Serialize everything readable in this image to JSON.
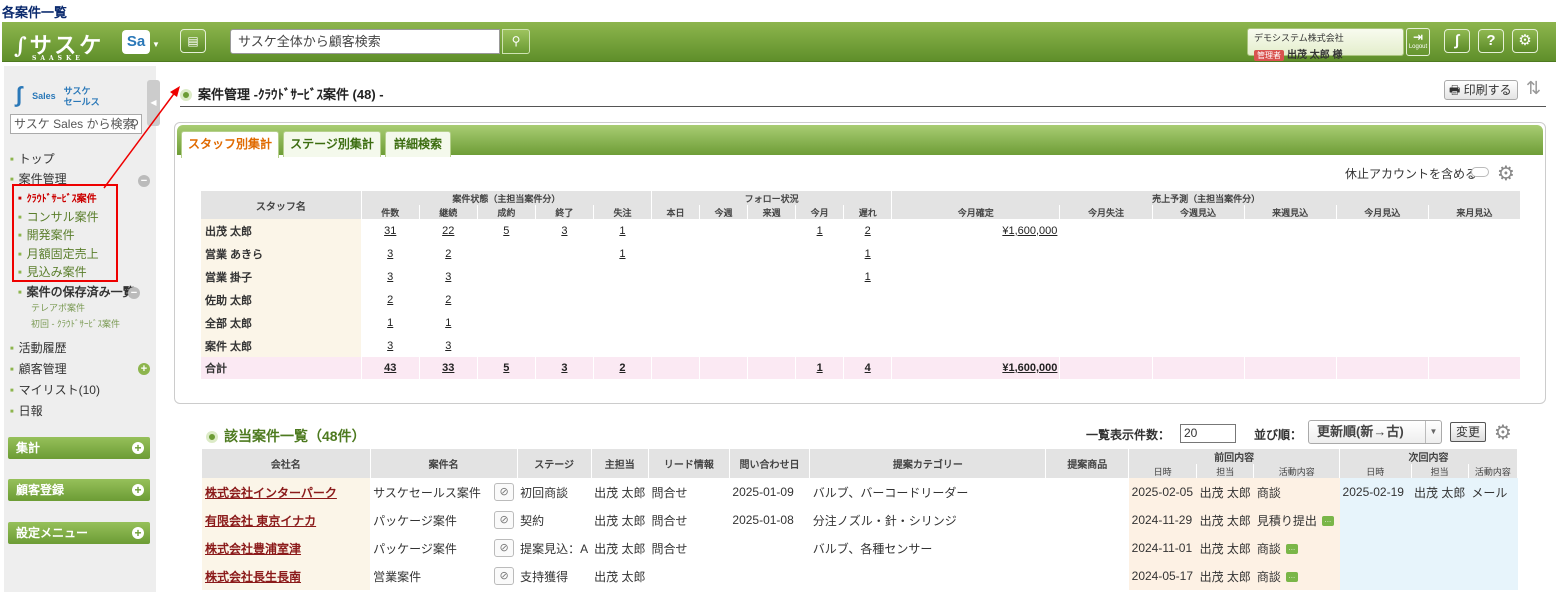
{
  "page_title": "各案件一覧",
  "topbar": {
    "logo": "サスケ",
    "logo_sub": "SAASKE",
    "sa_label": "Sa",
    "search_placeholder": "サスケ全体から顧客検索",
    "company": "デモシステム株式会社",
    "role_badge": "管理者",
    "user": "出茂 太郎 様",
    "logout": "Logout"
  },
  "sidebar": {
    "sales_logo": "Sales",
    "sales_sub1": "サスケ",
    "sales_sub2": "セールス",
    "search_placeholder": "サスケ Sales から検索",
    "items": [
      "トップ",
      "案件管理",
      "ｸﾗｳﾄﾞｻｰﾋﾞｽ案件",
      "コンサル案件",
      "開発案件",
      "月額固定売上",
      "見込み案件",
      "案件の保存済み一覧",
      "テレアポ案件",
      "初回 - ｸﾗｳﾄﾞｻｰﾋﾞｽ案件",
      "活動履歴",
      "顧客管理",
      "マイリスト(10)",
      "日報"
    ],
    "sections": [
      "集計",
      "顧客登録",
      "設定メニュー"
    ]
  },
  "main": {
    "title": "案件管理 -ｸﾗｳﾄﾞｻｰﾋﾞｽ案件 (48) -",
    "print": "印刷する",
    "tabs": [
      "スタッフ別集計",
      "ステージ別集計",
      "詳細検索"
    ],
    "include_inactive": "休止アカウントを含める",
    "toggle_off": "OFF"
  },
  "summary": {
    "col_staff": "スタッフ名",
    "group_status": "案件状態（主担当案件分）",
    "group_follow": "フォロー状況",
    "group_forecast": "売上予測（主担当案件分）",
    "sub_status": [
      "件数",
      "継続",
      "成約",
      "終了",
      "失注"
    ],
    "sub_follow": [
      "本日",
      "今週",
      "来週",
      "今月",
      "遅れ"
    ],
    "sub_forecast": [
      "今月確定",
      "今月失注",
      "今週見込",
      "来週見込",
      "今月見込",
      "来月見込"
    ],
    "rows": [
      {
        "name": "出茂 太郎",
        "c": [
          "31",
          "22",
          "5",
          "3",
          "1",
          "",
          "",
          "",
          "1",
          "2",
          "¥1,600,000",
          "",
          "",
          "",
          "",
          ""
        ]
      },
      {
        "name": "営業 あきら",
        "c": [
          "3",
          "2",
          "",
          "",
          "1",
          "",
          "",
          "",
          "",
          "1",
          "",
          "",
          "",
          "",
          "",
          ""
        ]
      },
      {
        "name": "営業 掛子",
        "c": [
          "3",
          "3",
          "",
          "",
          "",
          "",
          "",
          "",
          "",
          "1",
          "",
          "",
          "",
          "",
          "",
          ""
        ]
      },
      {
        "name": "佐助 太郎",
        "c": [
          "2",
          "2",
          "",
          "",
          "",
          "",
          "",
          "",
          "",
          "",
          "",
          "",
          "",
          "",
          "",
          ""
        ]
      },
      {
        "name": "全部 太郎",
        "c": [
          "1",
          "1",
          "",
          "",
          "",
          "",
          "",
          "",
          "",
          "",
          "",
          "",
          "",
          "",
          "",
          ""
        ]
      },
      {
        "name": "案件 太郎",
        "c": [
          "3",
          "3",
          "",
          "",
          "",
          "",
          "",
          "",
          "",
          "",
          "",
          "",
          "",
          "",
          "",
          ""
        ]
      }
    ],
    "total": {
      "name": "合計",
      "c": [
        "43",
        "33",
        "5",
        "3",
        "2",
        "",
        "",
        "",
        "1",
        "4",
        "¥1,600,000",
        "",
        "",
        "",
        "",
        ""
      ]
    }
  },
  "list": {
    "title": "該当案件一覧（48件）",
    "per_page_label": "一覧表示件数：",
    "per_page": "20",
    "sort_label": "並び順：",
    "sort_value": "更新順(新→古)",
    "change": "変更",
    "headers": [
      "会社名",
      "案件名",
      "ステージ",
      "主担当",
      "リード情報",
      "問い合わせ日",
      "提案カテゴリー",
      "提案商品",
      "前回内容",
      "次回内容"
    ],
    "sub_headers": [
      "日時",
      "担当",
      "活動内容",
      "日時",
      "担当",
      "活動内容"
    ],
    "rows": [
      {
        "company": "株式会社インターパーク",
        "deal": "サスケセールス案件",
        "stage": "初回商談",
        "owner": "出茂 太郎",
        "lead": "問合せ",
        "date": "2025-01-09",
        "cat": "バルブ、バーコードリーダー",
        "product": "",
        "p_date": "2025-02-05",
        "p_staff": "出茂 太郎",
        "p_act": "商談",
        "n_date": "2025-02-19",
        "n_staff": "出茂 太郎",
        "n_act": "メール"
      },
      {
        "company": "有限会社 東京イナカ",
        "deal": "パッケージ案件",
        "stage": "契約",
        "owner": "出茂 太郎",
        "lead": "問合せ",
        "date": "2025-01-08",
        "cat": "分注ノズル・針・シリンジ",
        "product": "",
        "p_date": "2024-11-29",
        "p_staff": "出茂 太郎",
        "p_act": "見積り提出",
        "n_date": "",
        "n_staff": "",
        "n_act": ""
      },
      {
        "company": "株式会社豊浦室津",
        "deal": "パッケージ案件",
        "stage": "提案見込：A",
        "owner": "出茂 太郎",
        "lead": "問合せ",
        "date": "",
        "cat": "バルブ、各種センサー",
        "product": "",
        "p_date": "2024-11-01",
        "p_staff": "出茂 太郎",
        "p_act": "商談",
        "n_date": "",
        "n_staff": "",
        "n_act": ""
      },
      {
        "company": "株式会社長生長南",
        "deal": "営業案件",
        "stage": "支持獲得",
        "owner": "出茂 太郎",
        "lead": "",
        "date": "",
        "cat": "",
        "product": "",
        "p_date": "2024-05-17",
        "p_staff": "出茂 太郎",
        "p_act": "商談",
        "n_date": "",
        "n_staff": "",
        "n_act": ""
      }
    ]
  },
  "colors": {
    "accent_green": "#6c9c35",
    "highlight_red": "#e00000",
    "tab_active": "#e06a00"
  }
}
